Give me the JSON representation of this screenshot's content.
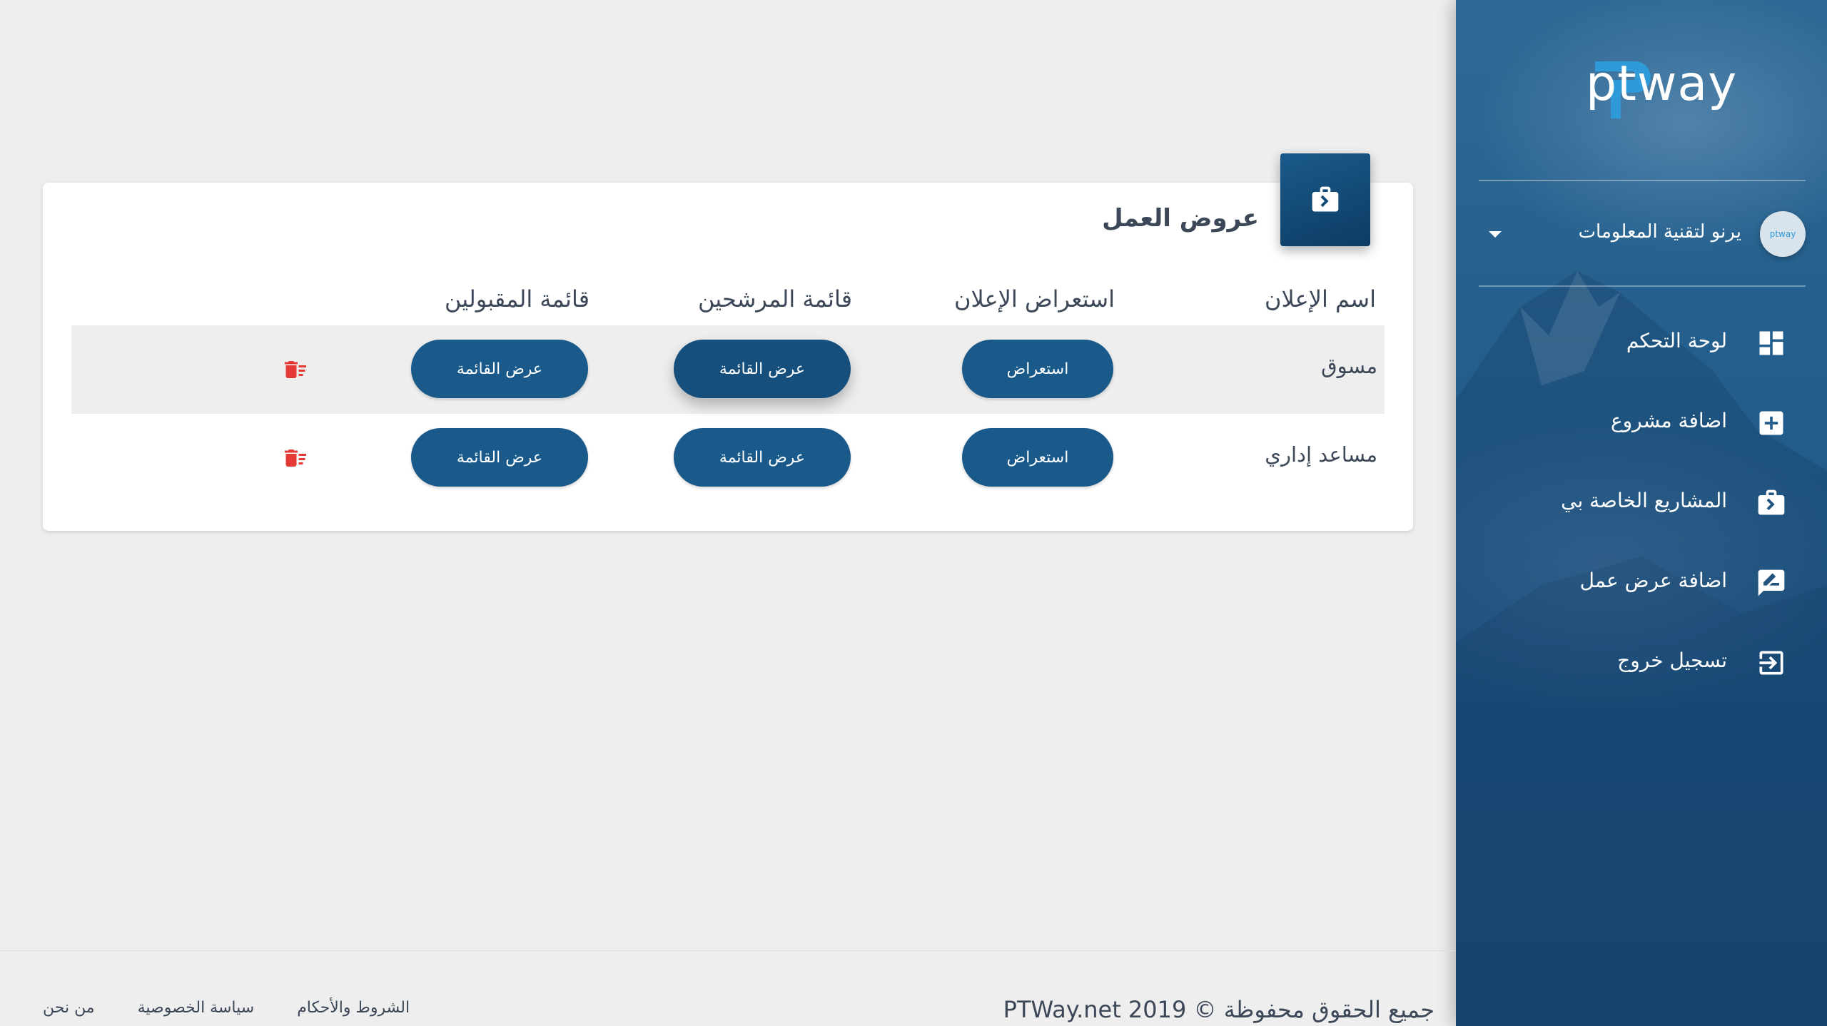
{
  "brand": {
    "name": "ptway",
    "color": "#2f9ad8"
  },
  "user": {
    "name": "يرنو لتقنية المعلومات",
    "avatar_text": "ptway"
  },
  "sidebar": {
    "items": [
      {
        "label": "لوحة التحكم",
        "icon": "dashboard-icon"
      },
      {
        "label": "اضافة مشروع",
        "icon": "add-box-icon"
      },
      {
        "label": "المشاريع الخاصة بي",
        "icon": "briefcase-icon"
      },
      {
        "label": "اضافة عرض عمل",
        "icon": "edit-note-icon"
      },
      {
        "label": "تسجيل خروج",
        "icon": "logout-icon"
      }
    ]
  },
  "card": {
    "title": "عروض العمل",
    "badge_icon": "briefcase-icon",
    "headers": {
      "name": "اسم الإعلان",
      "preview": "استعراض الإعلان",
      "candidates": "قائمة المرشحين",
      "accepted": "قائمة المقبولين"
    },
    "rows": [
      {
        "name": "مسوق",
        "preview_btn": "استعراض",
        "candidates_btn": "عرض القائمة",
        "accepted_btn": "عرض القائمة"
      },
      {
        "name": "مساعد إداري",
        "preview_btn": "استعراض",
        "candidates_btn": "عرض القائمة",
        "accepted_btn": "عرض القائمة"
      }
    ]
  },
  "footer": {
    "copyright": "جميع الحقوق محفوظة © PTWay.net 2019",
    "links": [
      "من نحن",
      "سياسة الخصوصية",
      "الشروط والأحكام"
    ]
  },
  "colors": {
    "primary": "#1a5a8b",
    "danger": "#e53935",
    "background": "#eeeeee"
  }
}
